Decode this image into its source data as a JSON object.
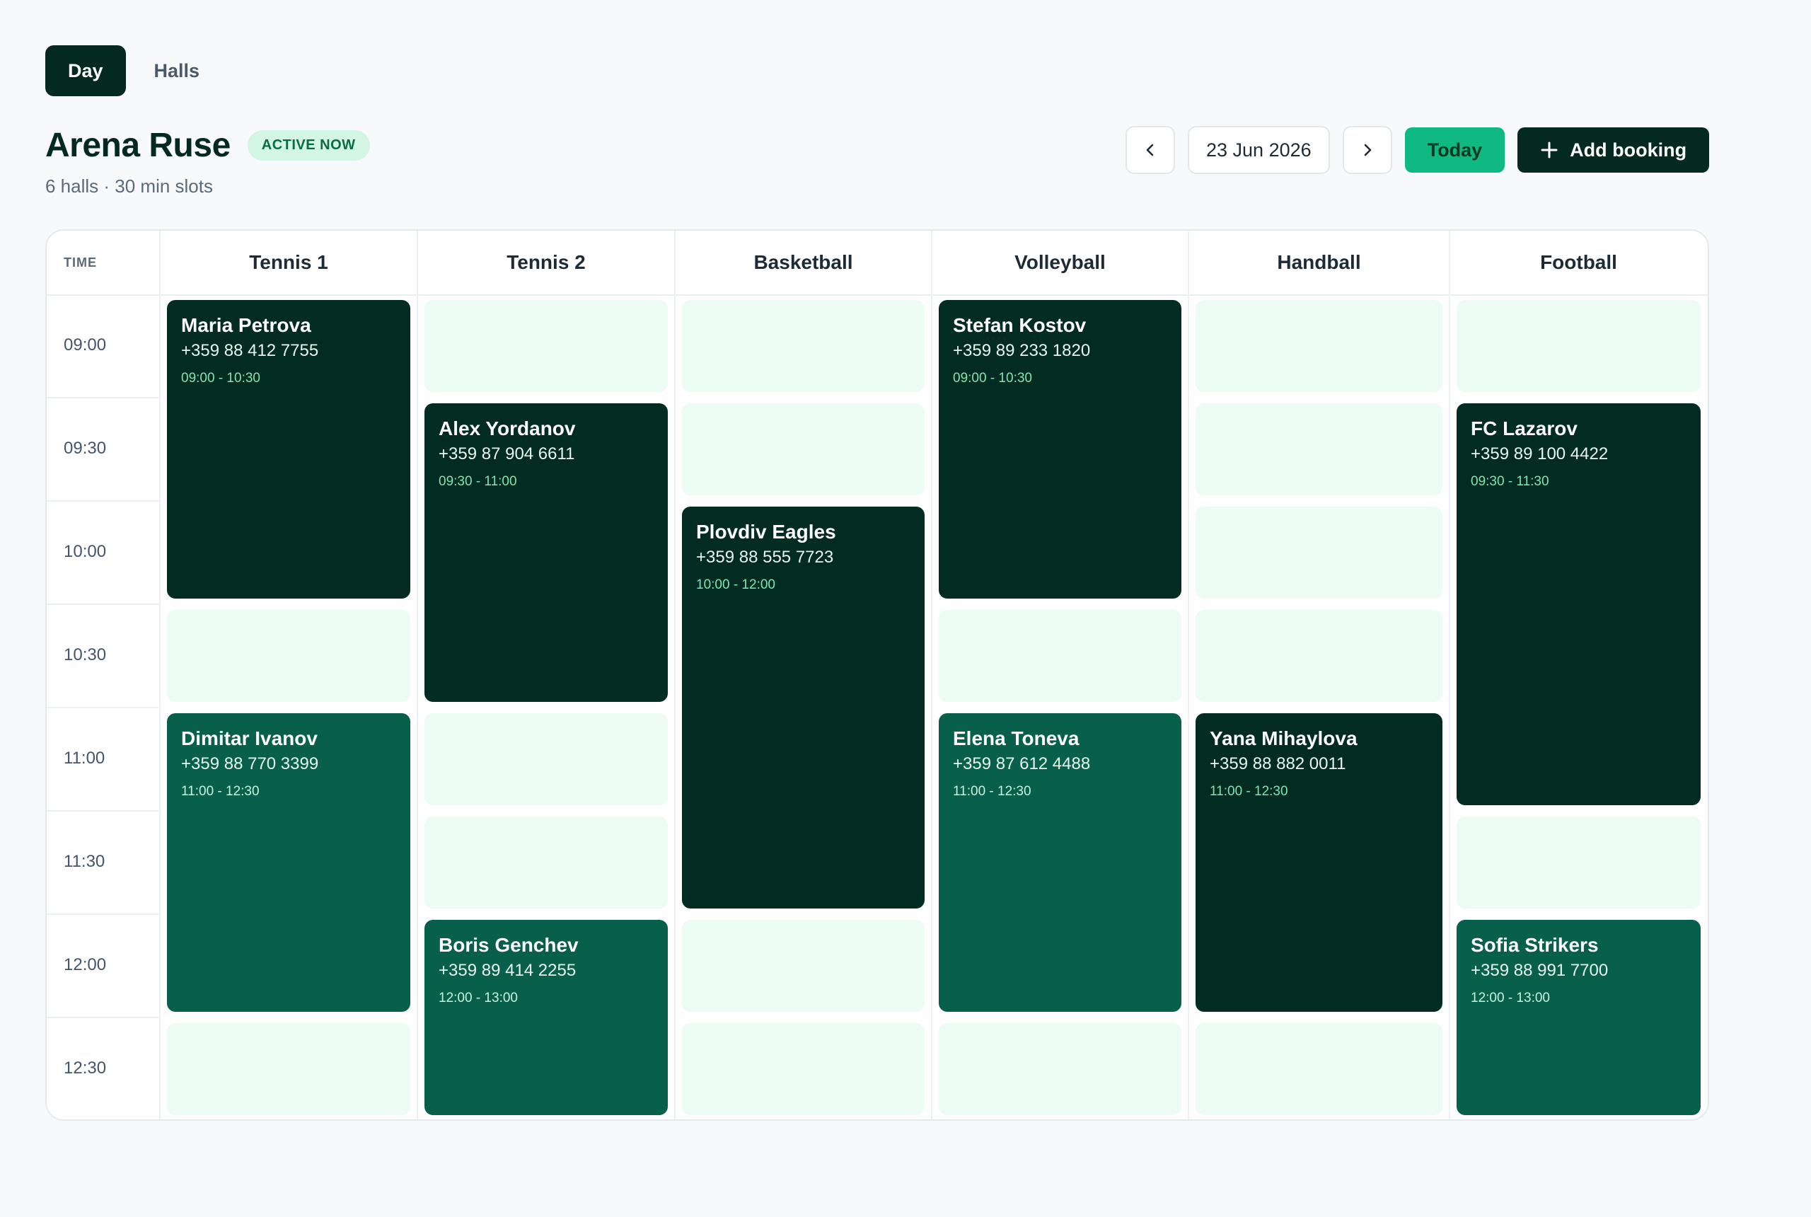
{
  "tabs": [
    {
      "label": "Day",
      "active": true
    },
    {
      "label": "Halls",
      "active": false
    }
  ],
  "venue": {
    "title": "Arena Ruse",
    "badge": "ACTIVE NOW",
    "subtitle": "6 halls · 30 min slots"
  },
  "toolbar": {
    "prev_icon": "chevron-left-icon",
    "date": "23 Jun 2026",
    "next_icon": "chevron-right-icon",
    "today_label": "Today",
    "add_label": "Add booking",
    "add_icon": "plus-icon"
  },
  "colors": {
    "accent": "#10b981",
    "dark": "#042a1f",
    "booking_dark": "#022b21",
    "booking_mid": "#08604a",
    "slot_free": "#ecfbf3"
  },
  "schedule": {
    "time_header": "TIME",
    "times": [
      "09:00",
      "09:30",
      "10:00",
      "10:30",
      "11:00",
      "11:30",
      "12:00",
      "12:30"
    ],
    "halls": [
      "Tennis 1",
      "Tennis 2",
      "Basketball",
      "Volleyball",
      "Handball",
      "Football"
    ],
    "bookings": [
      {
        "hall": 0,
        "start": 0,
        "slots": 3,
        "style": "dark",
        "name": "Maria Petrova",
        "phone": "+359 88 412 7755",
        "time": "09:00 - 10:30"
      },
      {
        "hall": 0,
        "start": 4,
        "slots": 3,
        "style": "mid",
        "name": "Dimitar Ivanov",
        "phone": "+359 88 770 3399",
        "time": "11:00 - 12:30"
      },
      {
        "hall": 1,
        "start": 1,
        "slots": 3,
        "style": "dark",
        "name": "Alex Yordanov",
        "phone": "+359 87 904 6611",
        "time": "09:30 - 11:00"
      },
      {
        "hall": 1,
        "start": 6,
        "slots": 2,
        "style": "mid",
        "name": "Boris Genchev",
        "phone": "+359 89 414 2255",
        "time": "12:00 - 13:00"
      },
      {
        "hall": 2,
        "start": 2,
        "slots": 4,
        "style": "dark",
        "name": "Plovdiv Eagles",
        "phone": "+359 88 555 7723",
        "time": "10:00 - 12:00"
      },
      {
        "hall": 3,
        "start": 0,
        "slots": 3,
        "style": "dark",
        "name": "Stefan Kostov",
        "phone": "+359 89 233 1820",
        "time": "09:00 - 10:30"
      },
      {
        "hall": 3,
        "start": 4,
        "slots": 3,
        "style": "mid",
        "name": "Elena Toneva",
        "phone": "+359 87 612 4488",
        "time": "11:00 - 12:30"
      },
      {
        "hall": 4,
        "start": 4,
        "slots": 3,
        "style": "dark",
        "name": "Yana Mihaylova",
        "phone": "+359 88 882 0011",
        "time": "11:00 - 12:30"
      },
      {
        "hall": 5,
        "start": 1,
        "slots": 4,
        "style": "dark",
        "name": "FC Lazarov",
        "phone": "+359 89 100 4422",
        "time": "09:30 - 11:30"
      },
      {
        "hall": 5,
        "start": 6,
        "slots": 2,
        "style": "mid",
        "name": "Sofia Strikers",
        "phone": "+359 88 991 7700",
        "time": "12:00 - 13:00"
      }
    ]
  }
}
